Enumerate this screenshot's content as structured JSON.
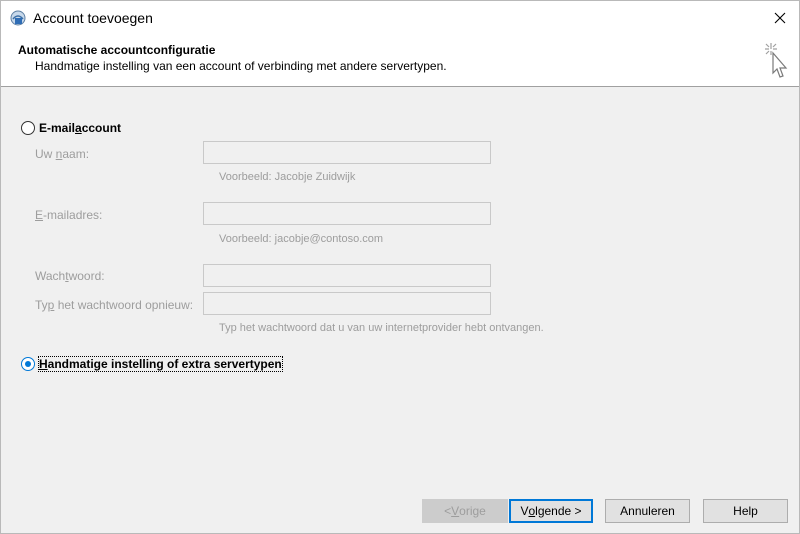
{
  "window": {
    "title": "Account toevoegen"
  },
  "header": {
    "title": "Automatische accountconfiguratie",
    "subtitle": "Handmatige instelling van een account of verbinding met andere servertypen."
  },
  "options": {
    "email_account": {
      "label_pre": "E-mail",
      "label_ul": "a",
      "label_post": "ccount",
      "selected": false
    },
    "manual": {
      "label_ul": "H",
      "label_post": "andmatige instelling of extra servertypen",
      "selected": true
    }
  },
  "fields": {
    "name": {
      "label_pre": "Uw ",
      "label_ul": "n",
      "label_post": "aam:",
      "value": "",
      "hint": "Voorbeeld: Jacobje Zuidwijk"
    },
    "email": {
      "label_pre": "",
      "label_ul": "E",
      "label_post": "-mailadres:",
      "value": "",
      "hint": "Voorbeeld: jacobje@contoso.com"
    },
    "password": {
      "label_pre": "Wach",
      "label_ul": "t",
      "label_post": "woord:",
      "value": ""
    },
    "password_repeat": {
      "label_pre": "Ty",
      "label_ul": "p",
      "label_post": " het wachtwoord opnieuw:",
      "value": "",
      "hint": "Typ het wachtwoord dat u van uw internetprovider hebt ontvangen."
    }
  },
  "buttons": {
    "back": {
      "pre": "< ",
      "ul": "V",
      "post": "orige",
      "enabled": false
    },
    "next": {
      "pre": "V",
      "ul": "o",
      "post": "lgende >",
      "enabled": true
    },
    "cancel": {
      "label": "Annuleren"
    },
    "help": {
      "label": "Help"
    }
  },
  "icons": {
    "app": "outlook-account-icon",
    "close": "close-icon",
    "wizard": "magic-cursor-icon"
  },
  "colors": {
    "accent": "#0078d7",
    "disabled_text": "#9d9d9d"
  }
}
